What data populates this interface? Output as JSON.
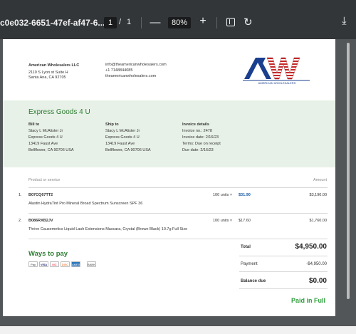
{
  "toolbar": {
    "title": "c0e032-6651-47ef-af47-6...",
    "page_current": "1",
    "page_separator": "/",
    "page_total": "1",
    "zoom_out": "—",
    "zoom_level": "80%",
    "zoom_in": "+",
    "icons": {
      "fit": "fit-page-icon",
      "rotate": "rotate-icon",
      "download": "download-icon"
    }
  },
  "seller": {
    "name": "American Wholesalers LLC",
    "address_line1": "2110 S Lyon st Suite H",
    "address_line2": "Santa Ana, CA 92705",
    "email": "info@theamericanwholesalers.com",
    "phone": "+1 7148844085",
    "website": "theamericanwholesalers.com",
    "logo_text": "AMERICAN WHOLESALERS"
  },
  "customer_name": "Express Goods 4 U",
  "bill_to": {
    "heading": "Bill to",
    "lines": [
      "Stacy L McAlister Jr",
      "Express Goods 4 U",
      "13419 Faust Ave",
      "Bellflower, CA 90706 USA"
    ]
  },
  "ship_to": {
    "heading": "Ship to",
    "lines": [
      "Stacy L McAlister Jr",
      "Express Goods 4 U",
      "13419 Faust Ave",
      "Bellflower, CA 90706 USA"
    ]
  },
  "invoice_details": {
    "heading": "Invoice details",
    "lines": [
      "Invoice no.: 2478",
      "Invoice date: 2/16/23",
      "Terms: Due on receipt",
      "Due date: 2/16/23"
    ]
  },
  "table": {
    "col_product": "Product or service",
    "col_amount": "Amount",
    "items": [
      {
        "num": "1.",
        "sku": "B07CQ67TT2",
        "description": "Alastin HydraTint Pro Mineral Broad Spectrum Sunscreen SPF 36",
        "qty_label": "100 units ×",
        "unit_price": "$31.90",
        "amount": "$3,190.00"
      },
      {
        "num": "2.",
        "sku": "B086RXB2JV",
        "description": "Thrive Causemetics Liquid Lash Extensions Mascara, Crystal (Brown Black) 10.7g Full Size",
        "qty_label": "100 units ×",
        "unit_price": "$17.60",
        "amount": "$1,760.00"
      }
    ]
  },
  "ways_to_pay": {
    "heading": "Ways to pay",
    "methods": [
      "Pay",
      "VISA",
      "MC",
      "DISC",
      "AMEX",
      "BANK"
    ]
  },
  "totals": {
    "total_label": "Total",
    "total_value": "$4,950.00",
    "payment_label": "Payment",
    "payment_value": "-$4,950.00",
    "balance_label": "Balance due",
    "balance_value": "$0.00",
    "status": "Paid in Full"
  },
  "colors": {
    "toolbar_bg": "#323639",
    "viewer_bg": "#525659",
    "band_bg": "#e8f1e8",
    "green_text": "#2e7d32",
    "paid_green": "#2e9e3c",
    "link_blue": "#1a5ea8"
  }
}
